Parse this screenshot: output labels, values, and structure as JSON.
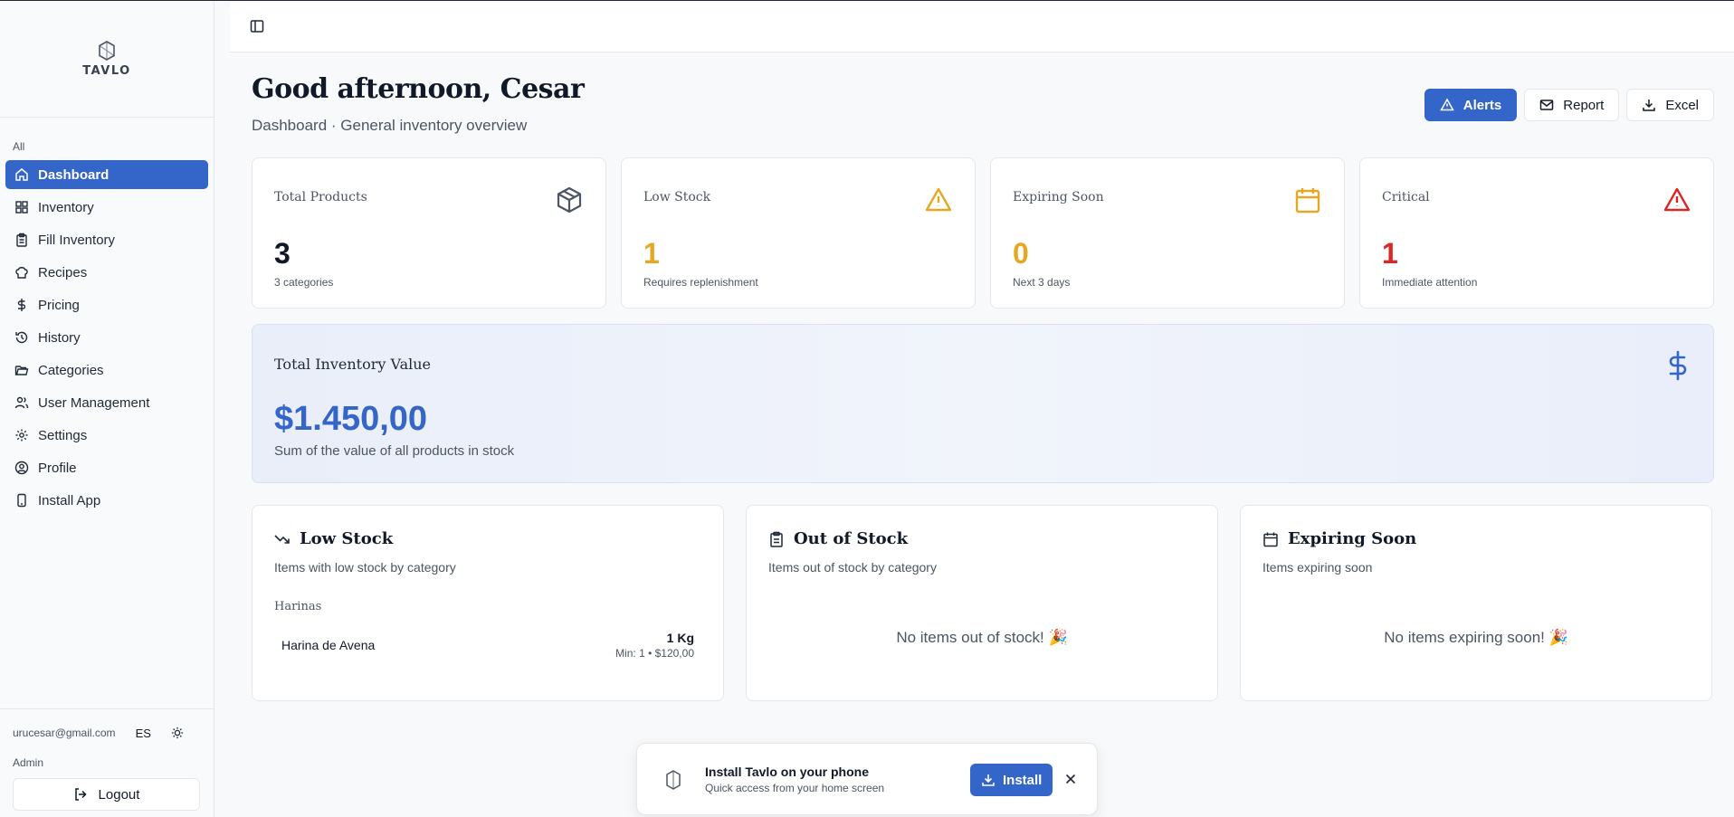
{
  "brand": {
    "name": "TAVLO"
  },
  "sidebar": {
    "section_label": "All",
    "items": [
      {
        "label": "Dashboard",
        "icon": "home-icon",
        "active": true
      },
      {
        "label": "Inventory",
        "icon": "grid-icon"
      },
      {
        "label": "Fill Inventory",
        "icon": "clipboard-icon"
      },
      {
        "label": "Recipes",
        "icon": "chef-hat-icon"
      },
      {
        "label": "Pricing",
        "icon": "dollar-icon"
      },
      {
        "label": "History",
        "icon": "history-icon"
      },
      {
        "label": "Categories",
        "icon": "folder-icon"
      },
      {
        "label": "User Management",
        "icon": "users-icon"
      },
      {
        "label": "Settings",
        "icon": "gear-icon"
      },
      {
        "label": "Profile",
        "icon": "user-circle-icon"
      },
      {
        "label": "Install App",
        "icon": "smartphone-icon"
      }
    ],
    "footer": {
      "email": "urucesar@gmail.com",
      "language": "ES",
      "role": "Admin",
      "logout_label": "Logout"
    }
  },
  "header": {
    "greeting": "Good afternoon, Cesar",
    "subtitle": "Dashboard · General inventory overview",
    "actions": {
      "alerts": "Alerts",
      "report": "Report",
      "excel": "Excel"
    }
  },
  "stats": [
    {
      "label": "Total Products",
      "value": "3",
      "sub": "3 categories",
      "icon": "box-icon",
      "color": "#111827",
      "icon_color": "#4b5563"
    },
    {
      "label": "Low Stock",
      "value": "1",
      "sub": "Requires replenishment",
      "icon": "warning-icon",
      "color": "#e5a823",
      "icon_color": "#e5a823"
    },
    {
      "label": "Expiring Soon",
      "value": "0",
      "sub": "Next 3 days",
      "icon": "calendar-icon",
      "color": "#e5a823",
      "icon_color": "#e5a823"
    },
    {
      "label": "Critical",
      "value": "1",
      "sub": "Immediate attention",
      "icon": "alert-triangle-icon",
      "color": "#dc2626",
      "icon_color": "#dc2626"
    }
  ],
  "inventory_value": {
    "label": "Total Inventory Value",
    "amount": "$1.450,00",
    "sub": "Sum of the value of all products in stock",
    "accent": "#3465c9"
  },
  "panels": {
    "low_stock": {
      "title": "Low Stock",
      "desc": "Items with low stock by category",
      "category": "Harinas",
      "item": {
        "name": "Harina de Avena",
        "qty": "1 Kg",
        "min": "Min: 1 • $120,00"
      }
    },
    "out_of_stock": {
      "title": "Out of Stock",
      "desc": "Items out of stock by category",
      "empty": "No items out of stock! 🎉"
    },
    "expiring": {
      "title": "Expiring Soon",
      "desc": "Items expiring soon",
      "empty": "No items expiring soon! 🎉"
    }
  },
  "install_banner": {
    "title": "Install Tavlo on your phone",
    "sub": "Quick access from your home screen",
    "button": "Install"
  }
}
